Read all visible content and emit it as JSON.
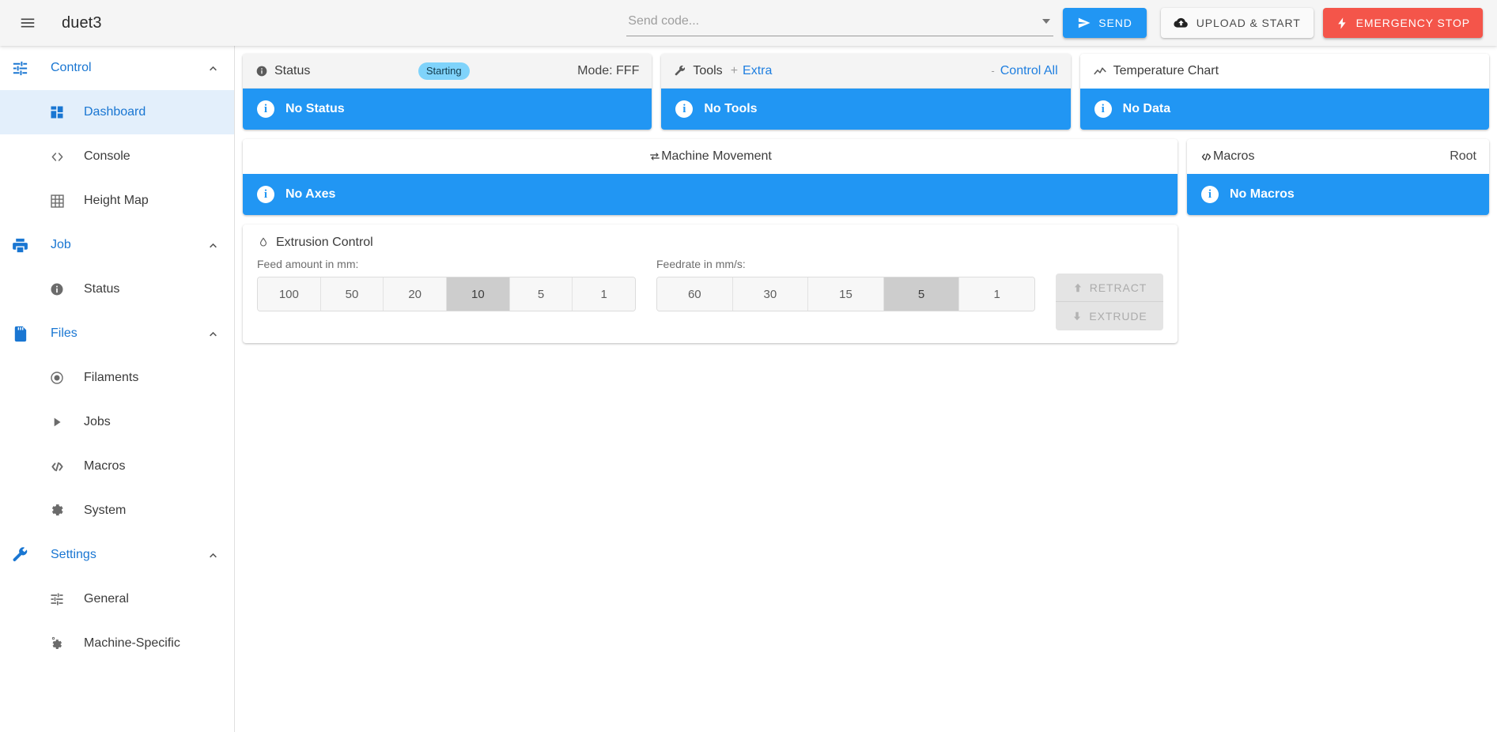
{
  "topbar": {
    "menu_icon": "hamburger-menu-icon",
    "brand": "duet3",
    "code_input": {
      "value": "",
      "placeholder": "Send code..."
    },
    "send_label": "SEND",
    "upload_label": "UPLOAD & START",
    "estop_label": "EMERGENCY STOP",
    "accent": "#2196f3",
    "danger": "#f4554a"
  },
  "sidebar": {
    "groups": [
      {
        "label": "Control",
        "icon": "tune-icon",
        "expanded": true,
        "items": [
          {
            "label": "Dashboard",
            "icon": "dashboard-icon",
            "active": true
          },
          {
            "label": "Console",
            "icon": "code-brackets-icon",
            "active": false
          },
          {
            "label": "Height Map",
            "icon": "grid-icon",
            "active": false
          }
        ]
      },
      {
        "label": "Job",
        "icon": "printer-icon",
        "expanded": true,
        "items": [
          {
            "label": "Status",
            "icon": "info-circle-icon",
            "active": false
          }
        ]
      },
      {
        "label": "Files",
        "icon": "sd-card-icon",
        "expanded": true,
        "items": [
          {
            "label": "Filaments",
            "icon": "radio-dot-icon",
            "active": false
          },
          {
            "label": "Jobs",
            "icon": "play-triangle-icon",
            "active": false
          },
          {
            "label": "Macros",
            "icon": "code-slash-icon",
            "active": false
          },
          {
            "label": "System",
            "icon": "gear-icon",
            "active": false
          }
        ]
      },
      {
        "label": "Settings",
        "icon": "wrench-icon",
        "expanded": true,
        "items": [
          {
            "label": "General",
            "icon": "tune-icon",
            "active": false
          },
          {
            "label": "Machine-Specific",
            "icon": "gear-cog-icon",
            "active": false
          }
        ]
      }
    ]
  },
  "status_card": {
    "title": "Status",
    "icon": "info-circle-icon",
    "badge": "Starting",
    "mode": "Mode: FFF",
    "alert": "No Status"
  },
  "tools_card": {
    "title": "Tools",
    "icon": "wrench-icon",
    "plus": "+",
    "extra_link": "Extra",
    "dash": "-",
    "control_all_link": "Control All",
    "alert": "No Tools"
  },
  "temperature_card": {
    "title": "Temperature Chart",
    "icon": "line-chart-icon",
    "alert": "No Data"
  },
  "movement_card": {
    "title": "Machine Movement",
    "icon": "swap-horizontal-icon",
    "alert": "No Axes"
  },
  "macros_card": {
    "title": "Macros",
    "icon": "code-slash-icon",
    "right_label": "Root",
    "alert": "No Macros"
  },
  "extrusion_card": {
    "title": "Extrusion Control",
    "icon": "water-drop-icon",
    "feed_amount_label": "Feed amount in mm:",
    "feed_amounts": [
      "100",
      "50",
      "20",
      "10",
      "5",
      "1"
    ],
    "feed_amount_selected": "10",
    "feedrate_label": "Feedrate in mm/s:",
    "feedrates": [
      "60",
      "30",
      "15",
      "5",
      "1"
    ],
    "feedrate_selected": "5",
    "retract_label": "RETRACT",
    "extrude_label": "EXTRUDE"
  }
}
